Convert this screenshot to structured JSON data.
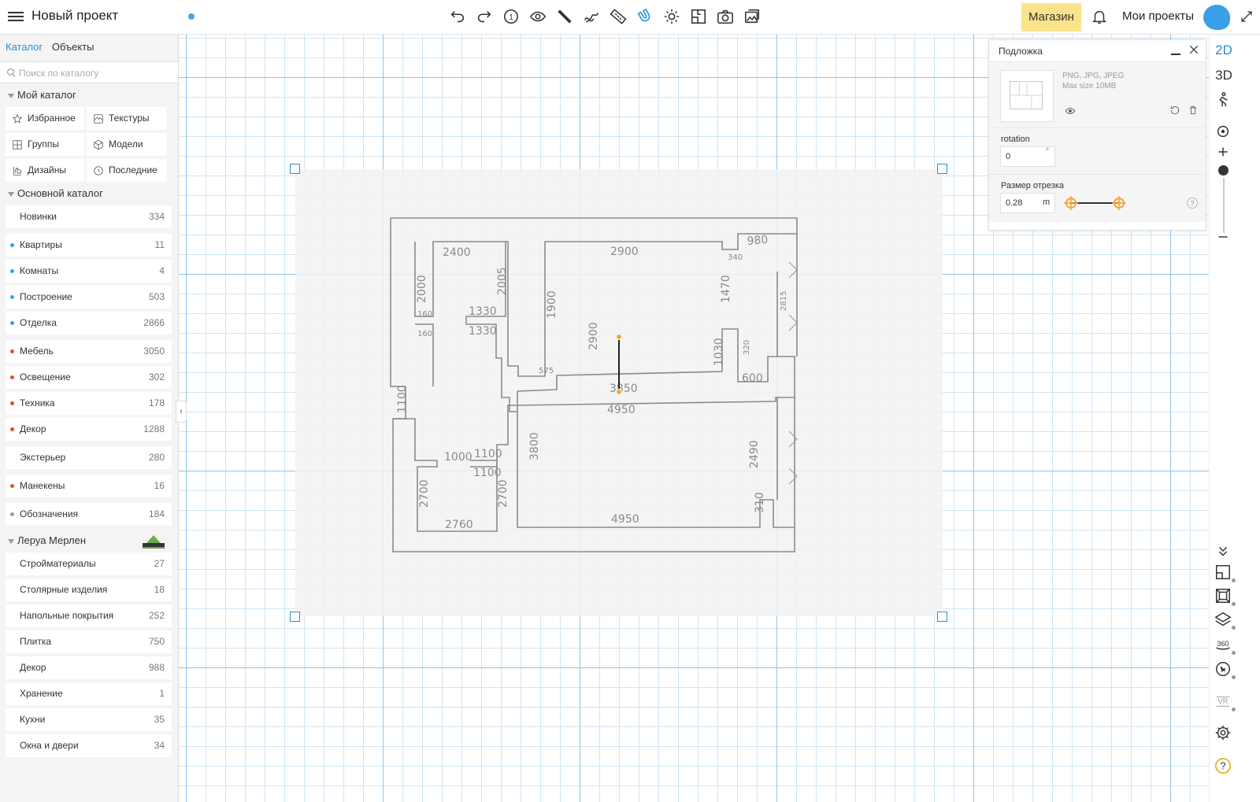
{
  "header": {
    "project_title": "Новый проект",
    "shop_label": "Магазин",
    "my_projects_label": "Мои проекты",
    "accent_color": "#2a8fd6",
    "shop_color": "#fbe38b"
  },
  "toolbar": {
    "icons": [
      "undo-icon",
      "redo-icon",
      "floor-1-icon",
      "eye-icon",
      "wall-tool-icon",
      "curve-tool-icon",
      "ruler-icon",
      "magnet-icon",
      "light-icon",
      "plan-view-icon",
      "camera-icon",
      "gallery-icon"
    ],
    "floor_number": "1"
  },
  "sidebar": {
    "tabs": {
      "catalog": "Каталог",
      "objects": "Объекты"
    },
    "search_placeholder": "Поиск по каталогу",
    "my_catalog": {
      "title": "Мой каталог",
      "items": [
        "Избранное",
        "Текстуры",
        "Группы",
        "Модели",
        "Дизайны",
        "Последние"
      ]
    },
    "main_catalog": {
      "title": "Основной каталог",
      "items": [
        {
          "label": "Новинки",
          "count": "334",
          "dot": ""
        },
        {
          "label": "Квартиры",
          "count": "11",
          "dot": "#2ea6e0"
        },
        {
          "label": "Комнаты",
          "count": "4",
          "dot": "#2ea6e0"
        },
        {
          "label": "Построение",
          "count": "503",
          "dot": "#2ea6e0"
        },
        {
          "label": "Отделка",
          "count": "2866",
          "dot": "#2ea6e0"
        },
        {
          "label": "Мебель",
          "count": "3050",
          "dot": "#d9532c"
        },
        {
          "label": "Освещение",
          "count": "302",
          "dot": "#d9532c"
        },
        {
          "label": "Техника",
          "count": "178",
          "dot": "#d9532c"
        },
        {
          "label": "Декор",
          "count": "1288",
          "dot": "#d9532c"
        },
        {
          "label": "Экстерьер",
          "count": "280",
          "dot": ""
        },
        {
          "label": "Манекены",
          "count": "16",
          "dot": "#d9532c"
        },
        {
          "label": "Обозначения",
          "count": "184",
          "dot": "#999999"
        }
      ]
    },
    "leroy": {
      "title": "Леруа Мерлен",
      "items": [
        {
          "label": "Стройматериалы",
          "count": "27"
        },
        {
          "label": "Столярные изделия",
          "count": "18"
        },
        {
          "label": "Напольные покрытия",
          "count": "252"
        },
        {
          "label": "Плитка",
          "count": "750"
        },
        {
          "label": "Декор",
          "count": "988"
        },
        {
          "label": "Хранение",
          "count": "1"
        },
        {
          "label": "Кухни",
          "count": "35"
        },
        {
          "label": "Окна и двери",
          "count": "34"
        }
      ]
    }
  },
  "right_bar": {
    "view_2d": "2D",
    "view_3d": "3D"
  },
  "panel": {
    "title": "Подложка",
    "formats": "PNG, JPG, JPEG",
    "max_size": "Max size 10MB",
    "rotation_label": "rotation",
    "rotation_value": "0",
    "rotation_unit": "°",
    "segment_label": "Размер отрезка",
    "segment_value": "0.28",
    "segment_unit": "m"
  },
  "plan": {
    "dimensions": [
      "2400",
      "2900",
      "980",
      "2000",
      "2005",
      "1900",
      "1330",
      "1330",
      "2900",
      "1470",
      "3850",
      "4950",
      "1030",
      "600",
      "1100",
      "1000",
      "1100",
      "1100",
      "3800",
      "2700",
      "2700",
      "2760",
      "4950",
      "2490",
      "310",
      "160",
      "160",
      "575",
      "340",
      "320",
      "2815"
    ]
  }
}
